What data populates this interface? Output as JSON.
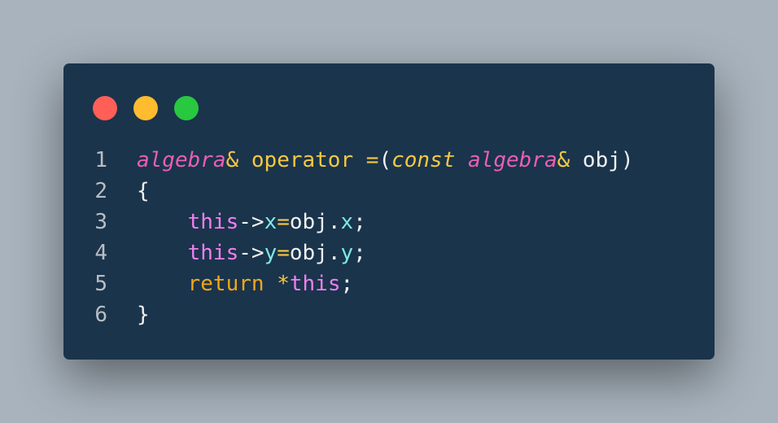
{
  "window": {
    "controls": [
      {
        "name": "close",
        "color": "#ff5f57"
      },
      {
        "name": "minimize",
        "color": "#febc2e"
      },
      {
        "name": "maximize",
        "color": "#28c840"
      }
    ]
  },
  "colors": {
    "type": "#e85fb4",
    "keyword": "#f5c842",
    "member": "#7ee8e6",
    "this": "#f07ff0",
    "return": "#f2a81a",
    "text": "#f0f0f0",
    "line_number": "#b9bec3"
  },
  "code": {
    "lines": [
      {
        "number": "1",
        "tokens": [
          {
            "text": "algebra",
            "kind": "type",
            "italic": true
          },
          {
            "text": "&",
            "kind": "keyword"
          },
          {
            "text": " ",
            "kind": "text"
          },
          {
            "text": "operator",
            "kind": "keyword"
          },
          {
            "text": " ",
            "kind": "text"
          },
          {
            "text": "=",
            "kind": "keyword"
          },
          {
            "text": "(",
            "kind": "text"
          },
          {
            "text": "const",
            "kind": "keyword",
            "italic": true
          },
          {
            "text": " ",
            "kind": "text"
          },
          {
            "text": "algebra",
            "kind": "type",
            "italic": true
          },
          {
            "text": "&",
            "kind": "keyword"
          },
          {
            "text": " obj)",
            "kind": "text"
          }
        ]
      },
      {
        "number": "2",
        "tokens": [
          {
            "text": "{",
            "kind": "text"
          }
        ]
      },
      {
        "number": "3",
        "tokens": [
          {
            "text": "    ",
            "kind": "text"
          },
          {
            "text": "this",
            "kind": "this"
          },
          {
            "text": "->",
            "kind": "text"
          },
          {
            "text": "x",
            "kind": "member"
          },
          {
            "text": "=",
            "kind": "keyword"
          },
          {
            "text": "obj.",
            "kind": "text"
          },
          {
            "text": "x",
            "kind": "member"
          },
          {
            "text": ";",
            "kind": "text"
          }
        ]
      },
      {
        "number": "4",
        "tokens": [
          {
            "text": "    ",
            "kind": "text"
          },
          {
            "text": "this",
            "kind": "this"
          },
          {
            "text": "->",
            "kind": "text"
          },
          {
            "text": "y",
            "kind": "member"
          },
          {
            "text": "=",
            "kind": "keyword"
          },
          {
            "text": "obj.",
            "kind": "text"
          },
          {
            "text": "y",
            "kind": "member"
          },
          {
            "text": ";",
            "kind": "text"
          }
        ]
      },
      {
        "number": "5",
        "tokens": [
          {
            "text": "    ",
            "kind": "text"
          },
          {
            "text": "return",
            "kind": "return"
          },
          {
            "text": " ",
            "kind": "text"
          },
          {
            "text": "*",
            "kind": "keyword"
          },
          {
            "text": "this",
            "kind": "this"
          },
          {
            "text": ";",
            "kind": "text"
          }
        ]
      },
      {
        "number": "6",
        "tokens": [
          {
            "text": "}",
            "kind": "text"
          }
        ]
      }
    ]
  }
}
